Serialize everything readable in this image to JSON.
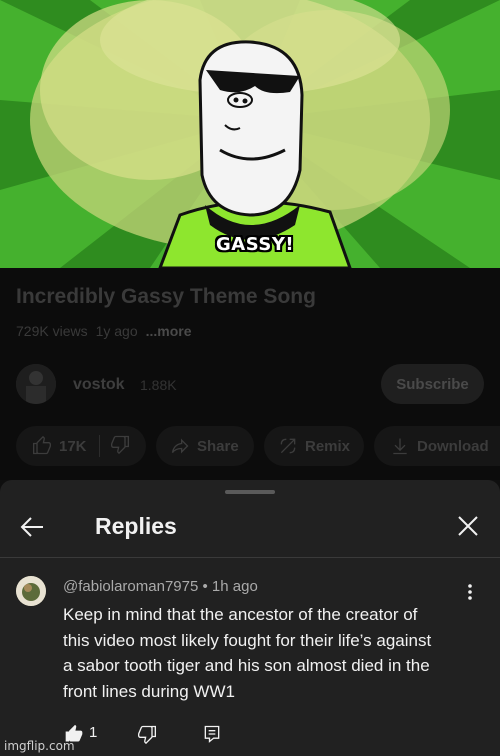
{
  "video": {
    "caption": "GASSY!"
  },
  "details": {
    "title": "Incredibly Gassy Theme Song",
    "views": "729K views",
    "age": "1y ago",
    "more": "...more"
  },
  "channel": {
    "name": "vostok",
    "subscribers": "1.88K",
    "subscribe_label": "Subscribe"
  },
  "actions": {
    "likes": "17K",
    "share": "Share",
    "remix": "Remix",
    "download": "Download"
  },
  "replies_panel": {
    "title": "Replies",
    "comment": {
      "author": "@fabiolaroman7975",
      "time": "1h ago",
      "text_lines": [
        "Keep in mind that the ancestor of the creator of",
        "this video most likely fought for their life’s against",
        "a sabor tooth tiger and his son almost died in the",
        "front lines during WW1"
      ],
      "likes": "1"
    }
  },
  "watermark": "imgflip.com",
  "icons": [
    "back-arrow-icon",
    "close-icon",
    "like-icon",
    "dislike-icon",
    "share-icon",
    "remix-icon",
    "download-icon",
    "more-vert-icon",
    "reply-icon"
  ]
}
